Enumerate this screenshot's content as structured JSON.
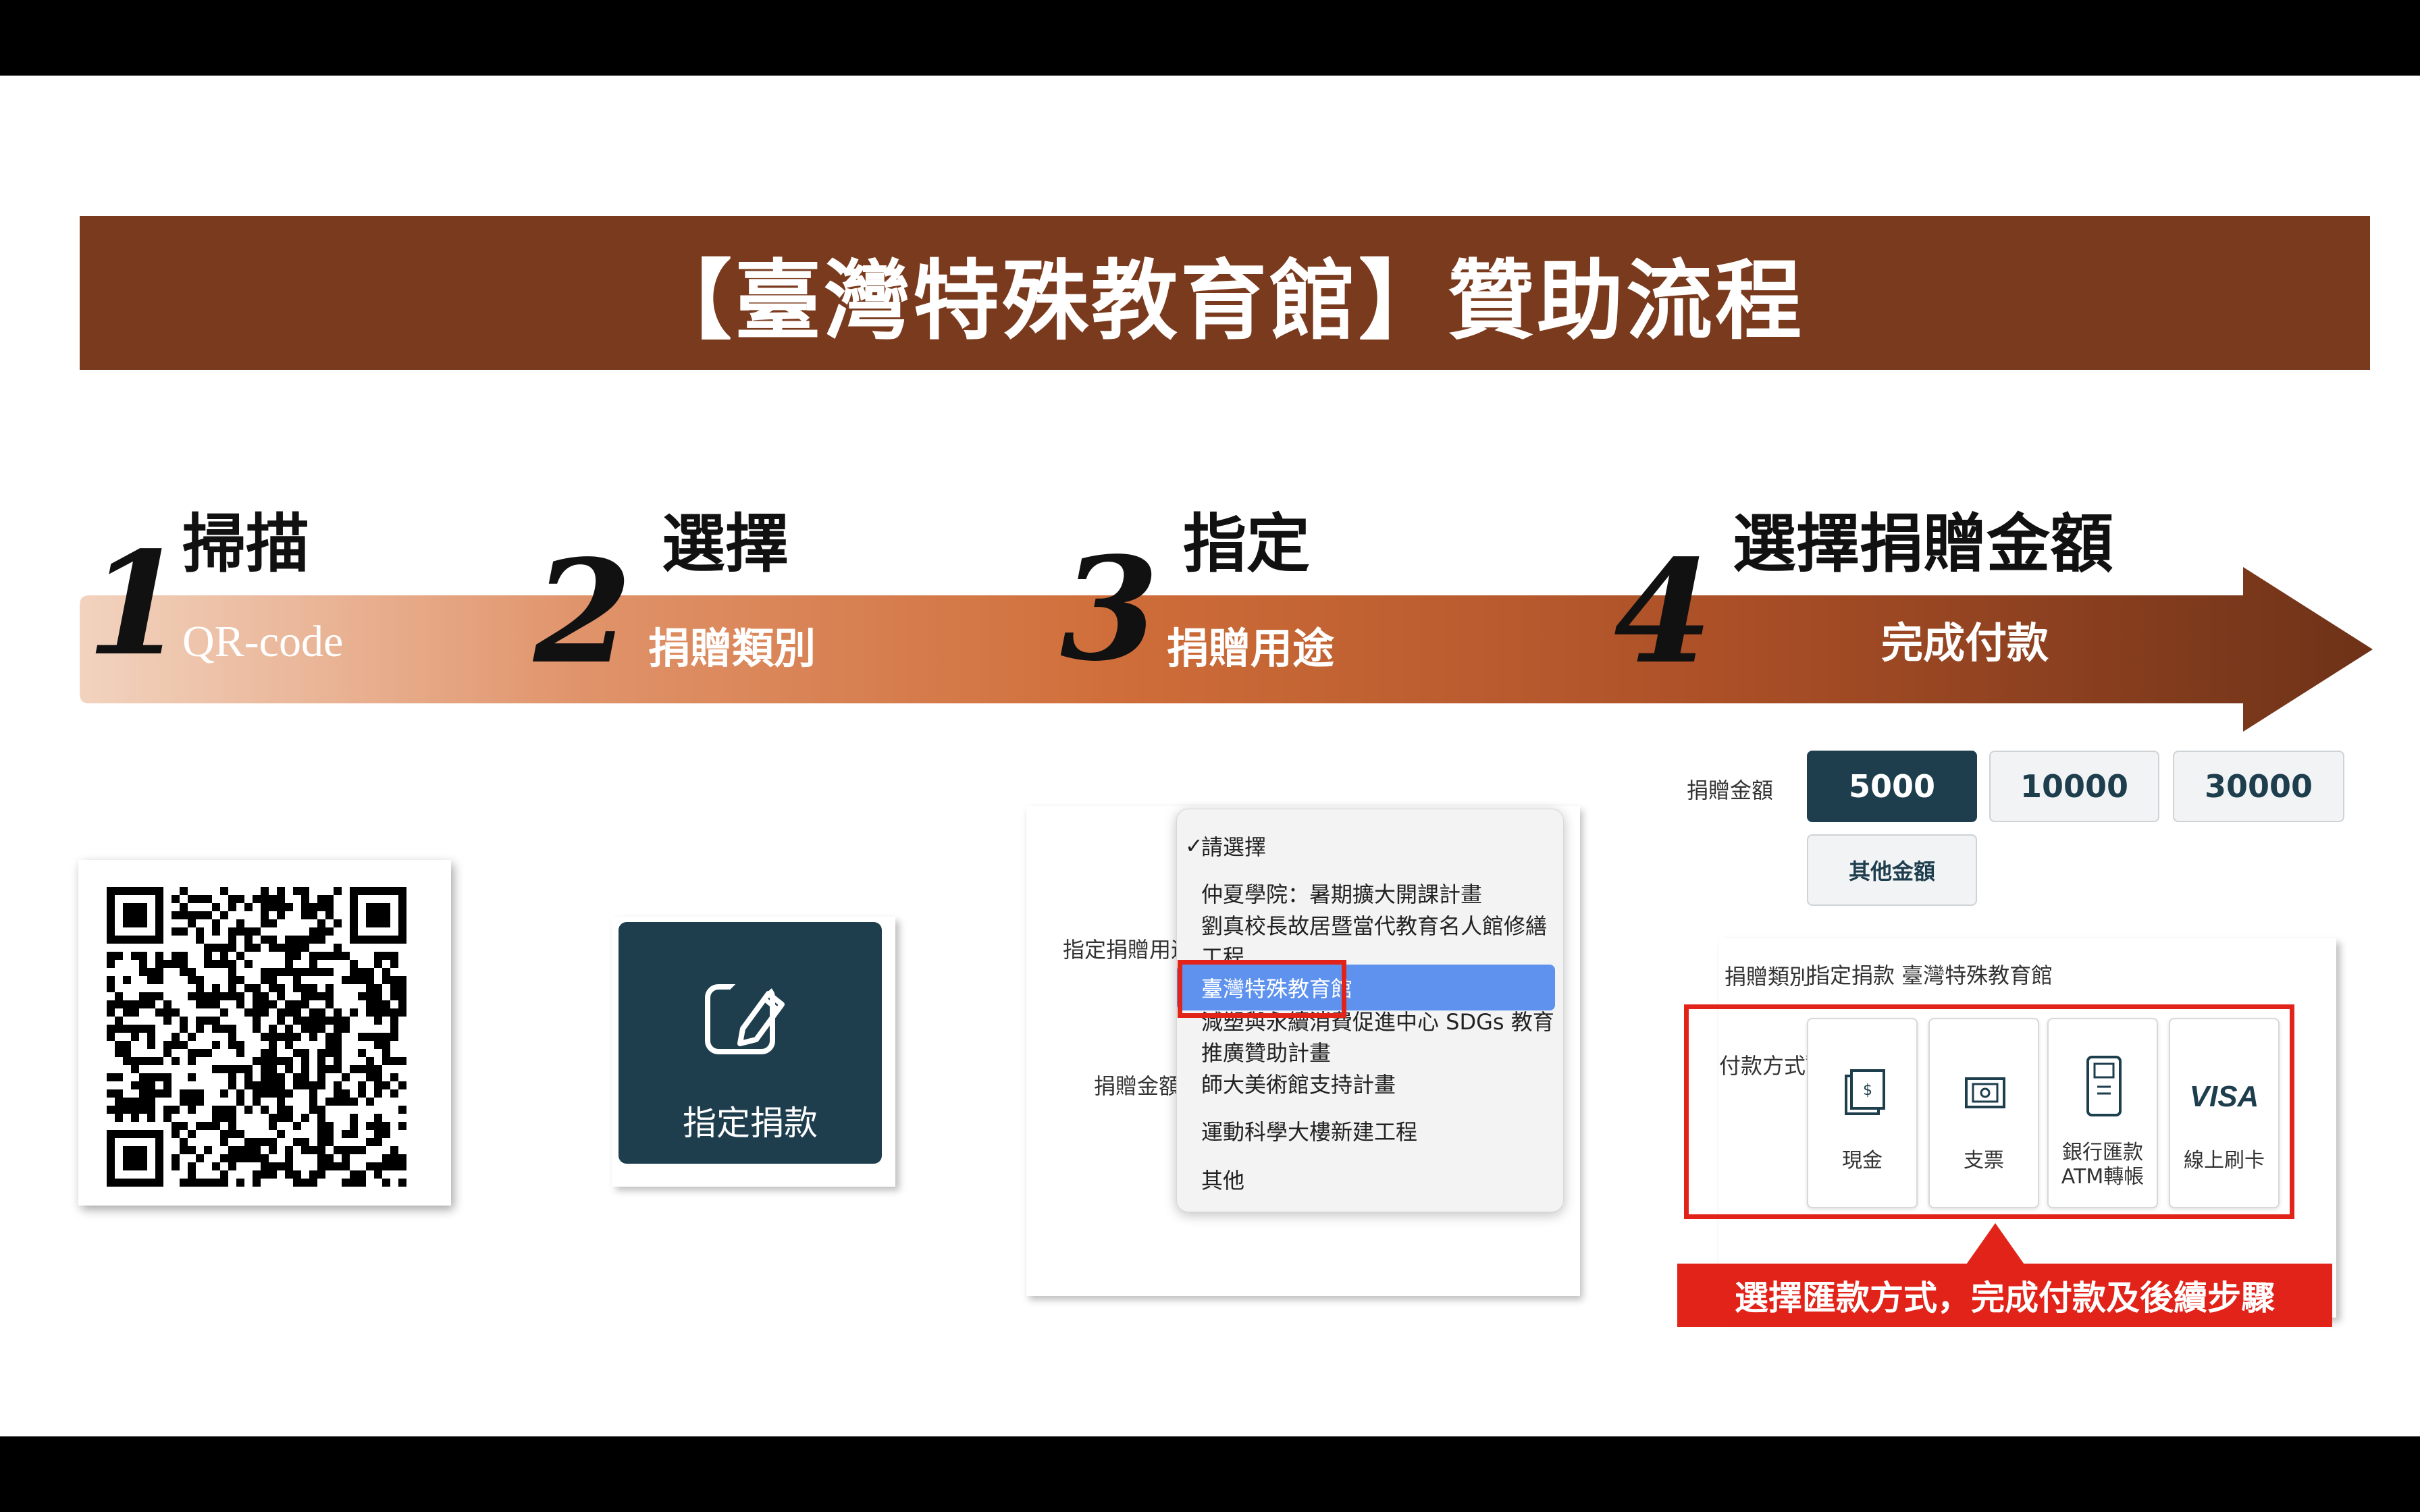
{
  "title": "【臺灣特殊教育館】贊助流程",
  "colors": {
    "banner": "#7a3a1d",
    "arrow_start": "#f0cdb6",
    "arrow_mid": "#cf6e3a",
    "arrow_end": "#6e3218",
    "navy": "#1e3e4e",
    "highlight_red": "#e2231a",
    "menu_selected": "#5e92ee"
  },
  "steps": [
    {
      "number": "1",
      "title": "掃描",
      "subtitle": "QR-code"
    },
    {
      "number": "2",
      "title": "選擇",
      "subtitle": "捐贈類別"
    },
    {
      "number": "3",
      "title": "指定",
      "subtitle": "捐贈用途"
    },
    {
      "number": "4",
      "title": "選擇捐贈金額",
      "subtitle": "完成付款"
    }
  ],
  "designated_button": {
    "label": "指定捐款",
    "icon": "edit-icon"
  },
  "purpose_form": {
    "purpose_label": "指定捐贈用途",
    "amount_label": "捐贈金額",
    "options": [
      "請選擇",
      "仲夏學院：暑期擴大開課計畫",
      "劉真校長故居暨當代教育名人館修繕工程",
      "臺灣特殊教育館",
      "減塑與永續消費促進中心 SDGs 教育推廣贊助計畫",
      "師大美術館支持計畫",
      "運動科學大樓新建工程",
      "其他"
    ],
    "checked_index": 0,
    "selected_index": 3,
    "check_mark": "✓"
  },
  "payment_form": {
    "amount_label": "捐贈金額",
    "amounts": [
      "5000",
      "10000",
      "30000"
    ],
    "selected_amount": "5000",
    "other_amount": "其他金額",
    "category_label": "捐贈類別",
    "category_value": "指定捐款 臺灣特殊教育館",
    "method_label": "付款方式",
    "required_mark": "*",
    "methods": [
      {
        "label_lines": [
          "現金"
        ],
        "icon": "cash-icon"
      },
      {
        "label_lines": [
          "支票"
        ],
        "icon": "cheque-icon"
      },
      {
        "label_lines": [
          "銀行匯款",
          "ATM轉帳"
        ],
        "icon": "atm-icon"
      },
      {
        "label_lines": [
          "線上刷卡"
        ],
        "icon": "visa-card-icon",
        "icon_text": "VISA"
      }
    ]
  },
  "callout": "選擇匯款方式，完成付款及後續步驟"
}
